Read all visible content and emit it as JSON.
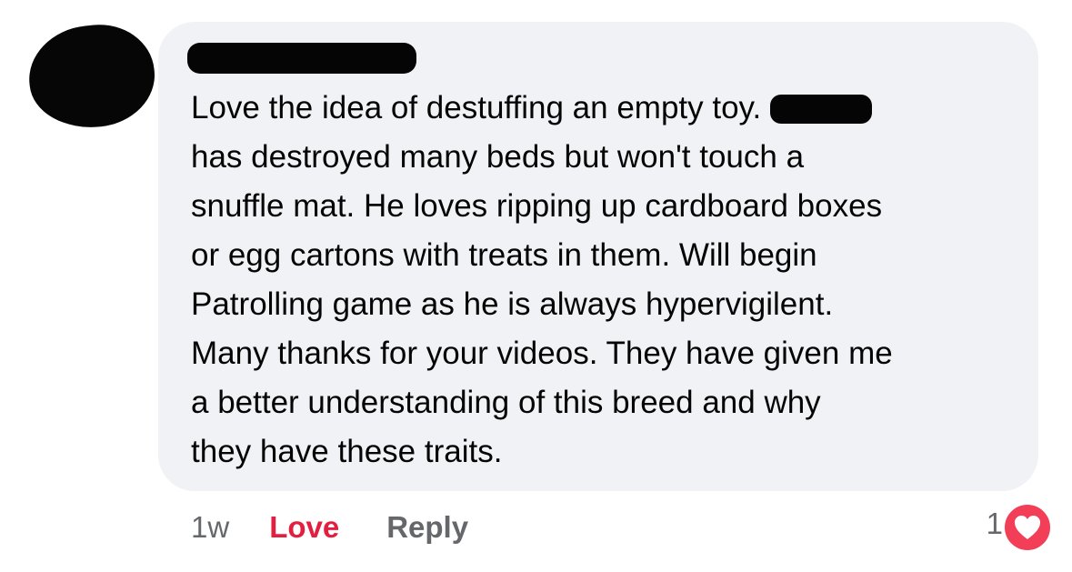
{
  "comment": {
    "lines": [
      "Love the idea of destuffing an empty toy.",
      "has destroyed many beds but won't touch a",
      "snuffle mat. He loves ripping up cardboard boxes",
      "or egg cartons with treats in them. Will begin",
      "Patrolling game as he is always hypervigilent.",
      "Many thanks for your videos. They have given me",
      "a better understanding of this breed and why",
      "they have these traits."
    ]
  },
  "actions": {
    "timestamp": "1w",
    "love_label": "Love",
    "reply_label": "Reply"
  },
  "reactions": {
    "count": "1",
    "icon": "heart-icon"
  },
  "colors": {
    "bubble": "#f0f2f5",
    "love_active": "#e41e3f",
    "muted_text": "#65676b",
    "heart_badge": "#f33e58"
  }
}
